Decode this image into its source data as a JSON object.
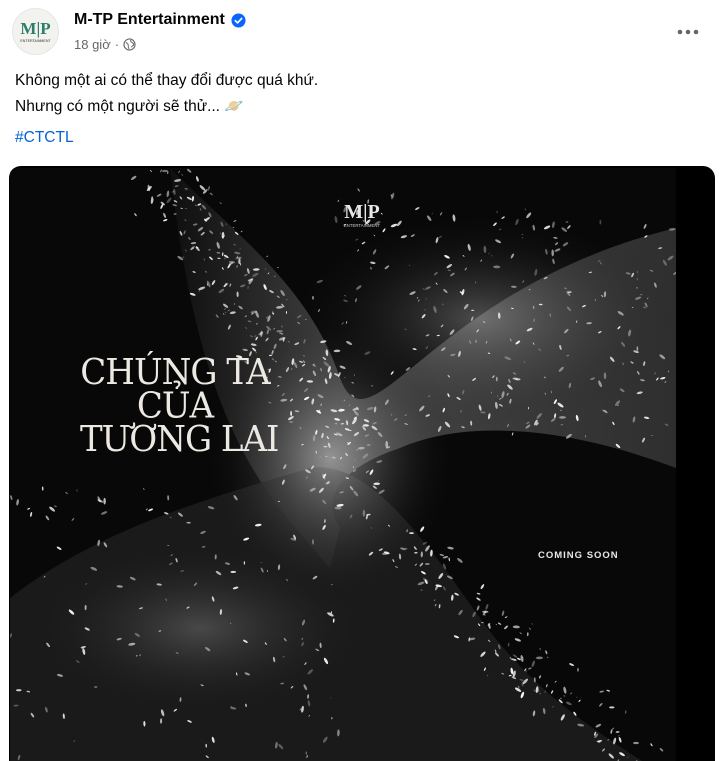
{
  "post": {
    "page_name": "M-TP Entertainment",
    "timestamp": "18 giờ",
    "separator": "·",
    "text_lines": [
      "Không một ai có thể thay đổi được quá khứ.",
      "Nhưng có một người sẽ thử... 🪐"
    ],
    "hashtag": "#CTCTL"
  },
  "avatar_logo": {
    "mark": "M|P",
    "subtitle": "ENTERTAINMENT"
  },
  "poster": {
    "logo_mark": "M|P",
    "logo_subtitle": "ENTERTAINMENT",
    "title_lines": [
      "CHÚNG TA",
      "CỦA",
      "TƯƠNG LAI"
    ],
    "tagline": "COMING SOON"
  },
  "icons": {
    "verified": "verified-badge-icon",
    "globe": "globe-icon",
    "more": "more-options-icon"
  },
  "colors": {
    "accent_blue": "#0866ff",
    "hashtag": "#0064d1",
    "secondary_text": "#65676b",
    "logo_green": "#2e7d6b"
  }
}
